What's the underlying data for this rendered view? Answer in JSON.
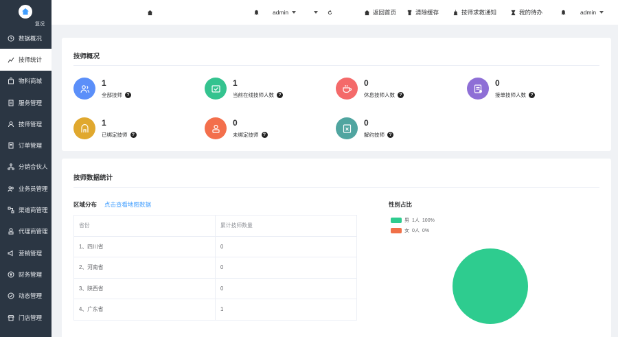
{
  "sidebar": {
    "logo_text": "复况",
    "items": [
      {
        "label": "数据概况",
        "icon": "clock-icon"
      },
      {
        "label": "技师统计",
        "icon": "chart-icon"
      },
      {
        "label": "物料商城",
        "icon": "bag-icon"
      },
      {
        "label": "服务管理",
        "icon": "document-icon"
      },
      {
        "label": "技师管理",
        "icon": "user-icon"
      },
      {
        "label": "订单管理",
        "icon": "order-icon"
      },
      {
        "label": "分销合伙人",
        "icon": "share-icon"
      },
      {
        "label": "业务员管理",
        "icon": "team-icon"
      },
      {
        "label": "渠道商管理",
        "icon": "channel-icon"
      },
      {
        "label": "代理商管理",
        "icon": "agent-icon"
      },
      {
        "label": "营销管理",
        "icon": "marketing-icon"
      },
      {
        "label": "财务管理",
        "icon": "finance-icon"
      },
      {
        "label": "动态管理",
        "icon": "dynamic-icon"
      },
      {
        "label": "门店管理",
        "icon": "store-icon"
      }
    ],
    "active_index": 1
  },
  "topbar": {
    "left_user": "admin",
    "back_home": "返回首页",
    "clear_cache": "清除缓存",
    "rescue_notice": "技师求救通知",
    "todo": "我的待办",
    "right_user": "admin"
  },
  "overview": {
    "title": "技师概况",
    "stats": [
      {
        "value": "1",
        "label": "全部技师",
        "color": "#5b8ff9"
      },
      {
        "value": "1",
        "label": "当前在线技师人数",
        "color": "#34c38f"
      },
      {
        "value": "0",
        "label": "休息技师人数",
        "color": "#f46a6a"
      },
      {
        "value": "0",
        "label": "接单技师人数",
        "color": "#8e6fd6"
      },
      {
        "value": "1",
        "label": "已绑定技师",
        "color": "#e0a82e"
      },
      {
        "value": "0",
        "label": "未绑定技师",
        "color": "#f36f4c"
      },
      {
        "value": "0",
        "label": "解约技师",
        "color": "#50a5a0"
      }
    ]
  },
  "stats_section": {
    "title": "技师数据统计",
    "region_label": "区域分布",
    "region_link": "点击查看地图数据",
    "table": {
      "headers": [
        "省份",
        "累计技师数量"
      ],
      "rows": [
        [
          "1、四川省",
          "0"
        ],
        [
          "2、河南省",
          "0"
        ],
        [
          "3、陕西省",
          "0"
        ],
        [
          "4、广东省",
          "1"
        ]
      ]
    },
    "gender_title": "性别占比"
  },
  "chart_data": {
    "type": "pie",
    "title": "性别占比",
    "series": [
      {
        "name": "男",
        "count": "1人",
        "percent": "100%",
        "value": 1,
        "color": "#2ecc8f"
      },
      {
        "name": "女",
        "count": "0人",
        "percent": "0%",
        "value": 0,
        "color": "#f07048"
      }
    ]
  }
}
